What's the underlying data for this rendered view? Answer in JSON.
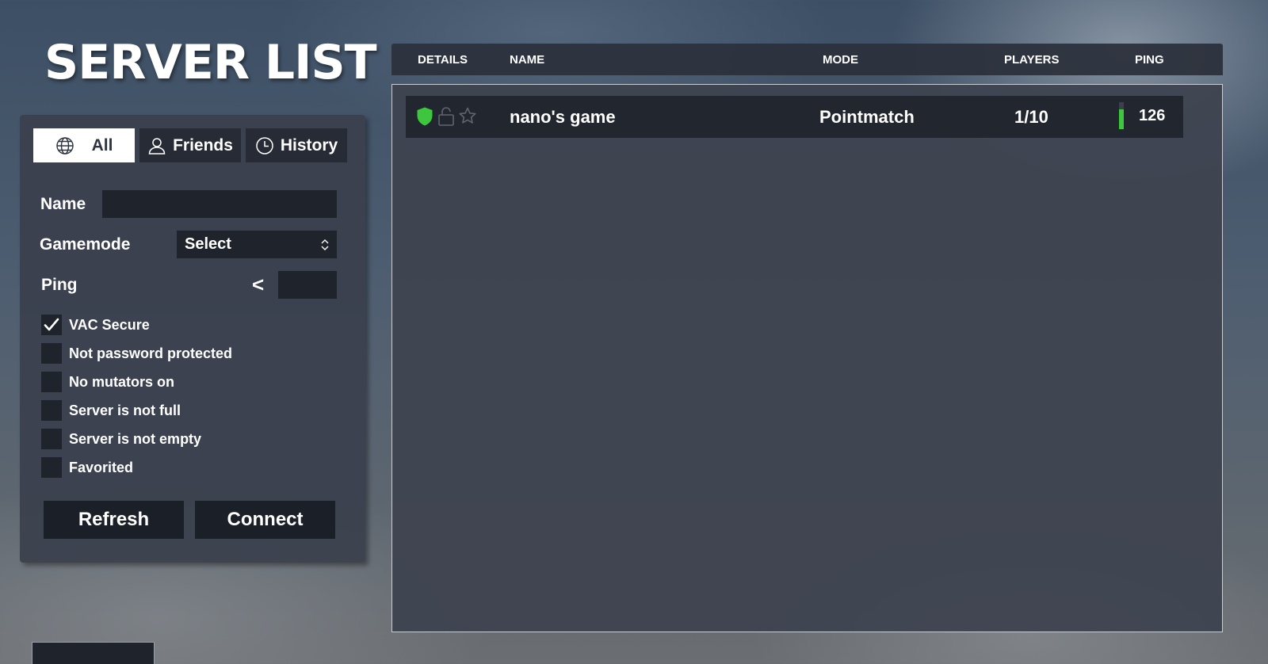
{
  "title": "SERVER LIST",
  "tabs": [
    {
      "label": "All",
      "icon": "globe-icon",
      "active": true
    },
    {
      "label": "Friends",
      "icon": "user-icon",
      "active": false
    },
    {
      "label": "History",
      "icon": "clock-icon",
      "active": false
    }
  ],
  "filters": {
    "name_label": "Name",
    "name_value": "",
    "gamemode_label": "Gamemode",
    "gamemode_value": "Select",
    "ping_label": "Ping",
    "ping_operator": "<",
    "ping_value": "",
    "checkboxes": [
      {
        "label": "VAC Secure",
        "checked": true
      },
      {
        "label": "Not password protected",
        "checked": false
      },
      {
        "label": "No mutators on",
        "checked": false
      },
      {
        "label": "Server is not full",
        "checked": false
      },
      {
        "label": "Server is not empty",
        "checked": false
      },
      {
        "label": "Favorited",
        "checked": false
      }
    ]
  },
  "buttons": {
    "refresh": "Refresh",
    "connect": "Connect"
  },
  "columns": {
    "details": "DETAILS",
    "name": "NAME",
    "mode": "MODE",
    "players": "PLAYERS",
    "ping": "PING"
  },
  "servers": [
    {
      "name": "nano's game",
      "mode": "Pointmatch",
      "players": "1/10",
      "ping": "126",
      "ping_level": 0.75,
      "vac_secure": true,
      "locked": false,
      "favorited": false
    }
  ],
  "colors": {
    "accent_green": "#3ec63e",
    "panel_bg": "#3a404c",
    "field_bg": "#1f232c"
  }
}
